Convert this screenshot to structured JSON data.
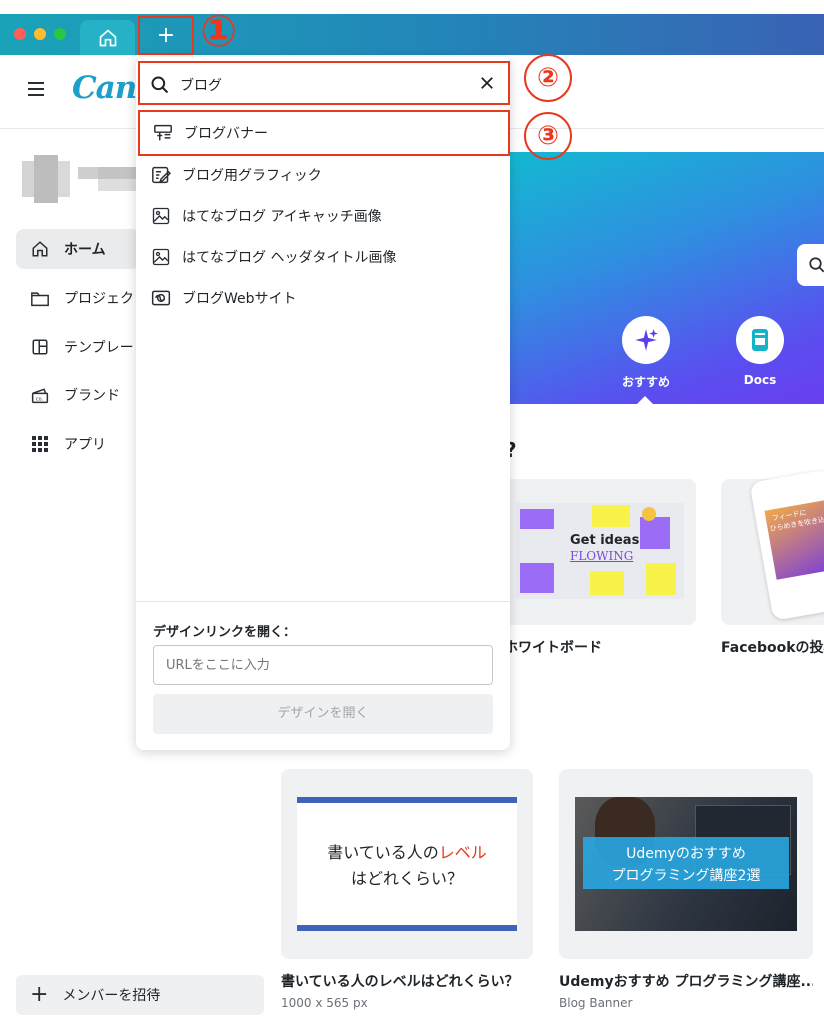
{
  "annotations": [
    "①",
    "②",
    "③"
  ],
  "header": {
    "logo": "Canva"
  },
  "sidebar": {
    "items": [
      {
        "label": "ホーム",
        "icon": "home-icon",
        "active": true
      },
      {
        "label": "プロジェクト",
        "icon": "folder-icon"
      },
      {
        "label": "テンプレート",
        "icon": "template-icon"
      },
      {
        "label": "ブランド",
        "icon": "brand-icon"
      },
      {
        "label": "アプリ",
        "icon": "apps-grid-icon"
      }
    ],
    "invite_label": "メンバーを招待"
  },
  "search": {
    "query": "ブログ",
    "results": [
      {
        "label": "ブログバナー",
        "icon": "banner-icon"
      },
      {
        "label": "ブログ用グラフィック",
        "icon": "graphic-edit-icon"
      },
      {
        "label": "はてなブログ アイキャッチ画像",
        "icon": "image-icon"
      },
      {
        "label": "はてなブログ ヘッダタイトル画像",
        "icon": "image-icon"
      },
      {
        "label": "ブログWebサイト",
        "icon": "website-icon"
      }
    ],
    "design_link_label": "デザインリンクを開く：",
    "url_placeholder": "URLをここに入力",
    "open_button": "デザインを開く"
  },
  "hero": {
    "tabs": [
      {
        "label": "おすすめ",
        "icon": "sparkle-icon"
      },
      {
        "label": "Docs",
        "icon": "docs-icon"
      }
    ]
  },
  "section_partial": "?",
  "cards": [
    {
      "title": "ホワイトボード",
      "image_text": [
        "Get ideas",
        "FLOWING"
      ]
    },
    {
      "title": "Facebookの投稿",
      "image_text": [
        "フィードに",
        "ひらめきを吹き込"
      ]
    },
    {
      "title": "書いている人のレベルはどれくらい？",
      "sub": "1000 x 565 px",
      "image_text": [
        "書いている人の",
        "レベル",
        "はどれくらい？"
      ]
    },
    {
      "title": "Udemyおすすめ プログラミング講座...",
      "sub": "Blog Banner",
      "image_text": [
        "Udemyのおすすめ",
        "プログラミング講座2選"
      ]
    }
  ],
  "colors": {
    "annotation": "#e8391f",
    "brand": "#1d9fc9",
    "accent_red": "#e8391f"
  }
}
